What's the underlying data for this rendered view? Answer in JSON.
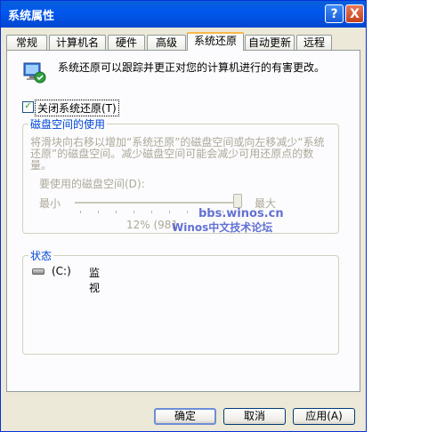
{
  "window": {
    "title": "系统属性",
    "help_glyph": "?",
    "close_glyph": "X"
  },
  "tabs": [
    {
      "label": "常规"
    },
    {
      "label": "计算机名"
    },
    {
      "label": "硬件"
    },
    {
      "label": "高级"
    },
    {
      "label": "系统还原",
      "active": true
    },
    {
      "label": "自动更新"
    },
    {
      "label": "远程"
    }
  ],
  "intro": {
    "icon": "system-restore-icon",
    "text": "系统还原可以跟踪并更正对您的计算机进行的有害更改。"
  },
  "disable_checkbox": {
    "checked": true,
    "check_glyph": "✓",
    "label": "关闭系统还原(T)"
  },
  "disk_space": {
    "title": "磁盘空间的使用",
    "description": "将滑块向右移以增加“系统还原”的磁盘空间或向左移减少“系统还原”的磁盘空间。减少磁盘空间可能会减少可用还原点的数量。",
    "usage_label": "要使用的磁盘空间(D):",
    "min_label": "最小",
    "max_label": "最大",
    "percent_text": "12% (981",
    "slider_value": 1.0
  },
  "watermark": {
    "line1": "bbs.winos.cn",
    "line2": "Winos中文技术论坛"
  },
  "status": {
    "title": "状态",
    "drives": [
      {
        "icon": "drive-icon",
        "label": "(C:)",
        "status": "监视"
      }
    ]
  },
  "buttons": {
    "ok": "确定",
    "cancel": "取消",
    "apply": "应用(A)"
  },
  "colors": {
    "accent": "#0046d5",
    "titlebar": "#0058ee",
    "active_tab_highlight": "#f9b84a"
  }
}
